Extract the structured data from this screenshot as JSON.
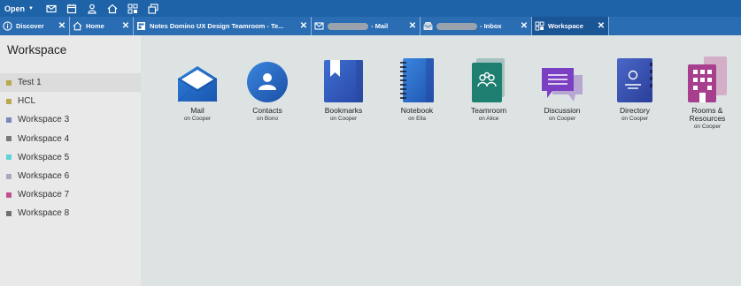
{
  "toolbar": {
    "open_label": "Open",
    "icons": [
      "mail-icon",
      "calendar-icon",
      "contacts-icon",
      "home-icon",
      "workspace-icon",
      "windows-icon"
    ]
  },
  "tabs": [
    {
      "icon": "info-icon",
      "label": "Discover",
      "close": "✕"
    },
    {
      "icon": "home-icon",
      "label": "Home",
      "close": "✕"
    },
    {
      "icon": "teamroom-icon",
      "label": "Notes Domino UX Design Teamroom - Te...",
      "close": "✕"
    },
    {
      "icon": "mail-icon",
      "label": "- Mail",
      "close": "✕"
    },
    {
      "icon": "inbox-icon",
      "label": "- Inbox",
      "close": "✕"
    },
    {
      "icon": "workspace-icon",
      "label": "Workspace",
      "close": "✕"
    }
  ],
  "sidebar": {
    "title": "Workspace",
    "items": [
      {
        "label": "Test 1",
        "color": "#b8a94a"
      },
      {
        "label": "HCL",
        "color": "#b8a94a"
      },
      {
        "label": "Workspace 3",
        "color": "#7b86b9"
      },
      {
        "label": "Workspace 4",
        "color": "#7a7a7a"
      },
      {
        "label": "Workspace 5",
        "color": "#5fd3d9"
      },
      {
        "label": "Workspace 6",
        "color": "#a9a9bd"
      },
      {
        "label": "Workspace 7",
        "color": "#c0508f"
      },
      {
        "label": "Workspace 8",
        "color": "#707070"
      }
    ]
  },
  "apps": [
    {
      "name": "Mail",
      "owner": "on Cooper",
      "icon": "mail-app-icon"
    },
    {
      "name": "Contacts",
      "owner": "on Bono",
      "icon": "contacts-app-icon"
    },
    {
      "name": "Bookmarks",
      "owner": "on Cooper",
      "icon": "bookmarks-app-icon"
    },
    {
      "name": "Notebook",
      "owner": "on Ella",
      "icon": "notebook-app-icon"
    },
    {
      "name": "Teamroom",
      "owner": "on Alice",
      "icon": "teamroom-app-icon"
    },
    {
      "name": "Discussion",
      "owner": "on Cooper",
      "icon": "discussion-app-icon"
    },
    {
      "name": "Directory",
      "owner": "on Cooper",
      "icon": "directory-app-icon"
    },
    {
      "name": "Rooms &\nResources",
      "owner": "on Cooper",
      "icon": "rooms-resources-app-icon"
    }
  ],
  "colors": {
    "toolbar": "#1e62a8",
    "tabbar": "#2a6db3",
    "active_tab": "#1a5596",
    "sidebar": "#e9e9e9",
    "main": "#dde3e3"
  }
}
